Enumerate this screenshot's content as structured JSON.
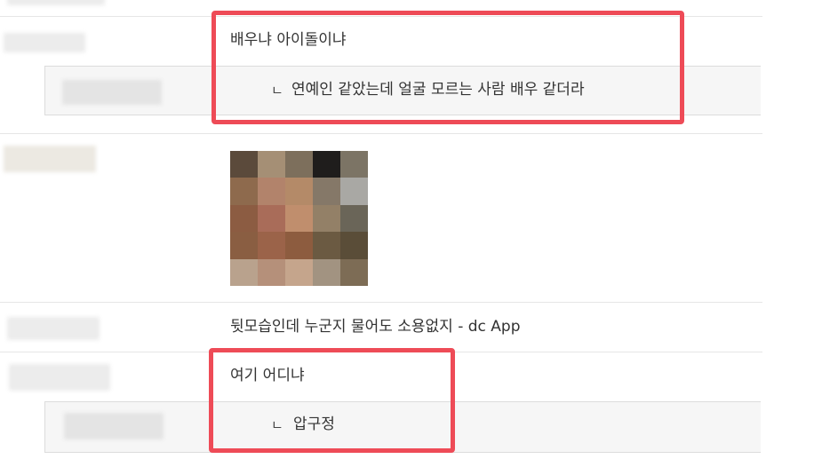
{
  "comments": [
    {
      "text": "배우냐 아이돌이냐"
    },
    {
      "reply_marker": "ㄴ",
      "text": "연예인 같았는데 얼굴 모르는 사람 배우 같더라"
    },
    {
      "image": "blurred-photo"
    },
    {
      "text": "뒷모습인데 누군지 물어도 소용없지 - dc App"
    },
    {
      "text": "여기 어디냐"
    },
    {
      "reply_marker": "ㄴ",
      "text": "압구정"
    }
  ],
  "colors": {
    "highlight": "#ee4b57",
    "reply_bg": "#f6f6f6",
    "divider": "#e6e6e6"
  },
  "mosaic_colors": [
    "#5b4a3b",
    "#a58f75",
    "#7d6f5c",
    "#1f1d1c",
    "#7c7465",
    "#8e6a4d",
    "#b2836b",
    "#b48a68",
    "#857868",
    "#a9a8a4",
    "#8c5c42",
    "#a96c59",
    "#c08e6d",
    "#938067",
    "#6a6558",
    "#8a5e42",
    "#9b6349",
    "#8d5c3f",
    "#6b5a42",
    "#5a4d38",
    "#b9a28d",
    "#b5907a",
    "#c5a58c",
    "#a29381",
    "#7d6c55"
  ]
}
